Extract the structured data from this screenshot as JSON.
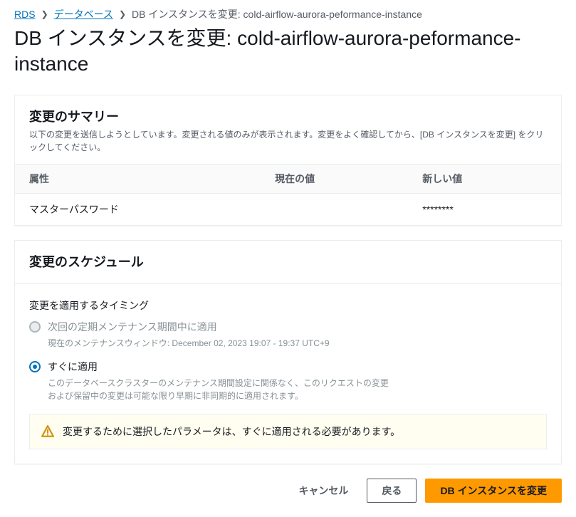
{
  "breadcrumb": {
    "root": "RDS",
    "databases": "データベース",
    "current": "DB インスタンスを変更: cold-airflow-aurora-peformance-instance"
  },
  "page_title": "DB インスタンスを変更: cold-airflow-aurora-peformance-instance",
  "summary": {
    "title": "変更のサマリー",
    "description": "以下の変更を送信しようとしています。変更される値のみが表示されます。変更をよく確認してから、[DB インスタンスを変更] をクリックしてください。",
    "columns": {
      "attribute": "属性",
      "current": "現在の値",
      "new": "新しい値"
    },
    "rows": [
      {
        "attribute": "マスターパスワード",
        "current": "",
        "new": "********"
      }
    ]
  },
  "schedule": {
    "title": "変更のスケジュール",
    "timing_label": "変更を適用するタイミング",
    "options": {
      "maintenance": {
        "label": "次回の定期メンテナンス期間中に適用",
        "hint": "現在のメンテナンスウィンドウ: December 02, 2023 19:07 - 19:37 UTC+9"
      },
      "immediate": {
        "label": "すぐに適用",
        "hint": "このデータベースクラスターのメンテナンス期間設定に関係なく、このリクエストの変更および保留中の変更は可能な限り早期に非同期的に適用されます。"
      }
    },
    "alert": "変更するために選択したパラメータは、すぐに適用される必要があります。"
  },
  "actions": {
    "cancel": "キャンセル",
    "back": "戻る",
    "submit": "DB インスタンスを変更"
  }
}
